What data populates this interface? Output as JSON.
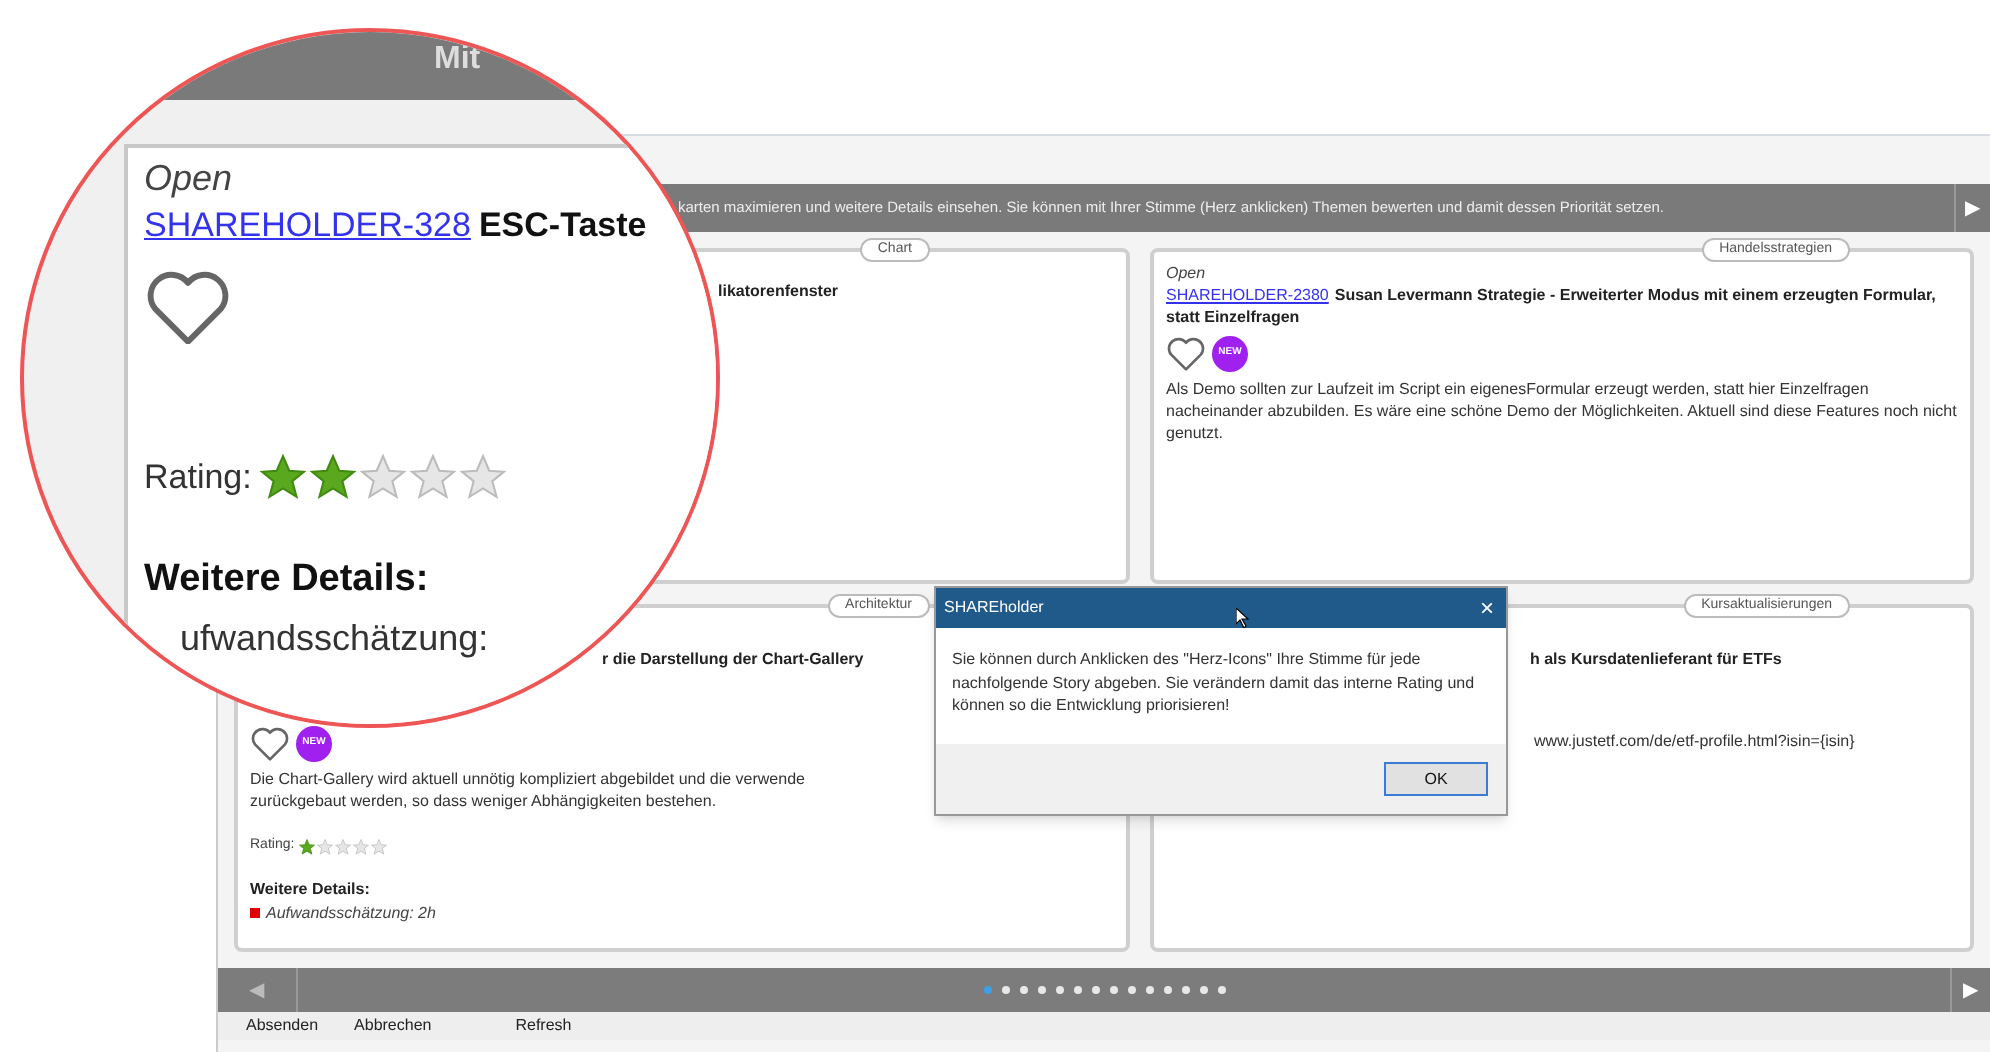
{
  "magnifier": {
    "header_text": "Mit",
    "status": "Open",
    "link": "SHAREHOLDER-328",
    "title": "ESC-Taste",
    "liked": false,
    "rating_label": "Rating:",
    "stars": 2,
    "details_heading": "Weitere Details:",
    "detail": "ufwandsschätzung:"
  },
  "info_bar": {
    "text": "karten maximieren und weitere Details einsehen. Sie können mit Ihrer Stimme (Herz anklicken) Themen bewerten und damit dessen Priorität setzen.",
    "next": "▶"
  },
  "cards": [
    {
      "category": "Chart",
      "title": "likatorenfenster"
    },
    {
      "category": "Handelsstrategien",
      "status": "Open",
      "link": "SHAREHOLDER-2380",
      "title": "Susan Levermann Strategie - Erweiterter Modus mit einem erzeugten Formular, statt Einzelfragen",
      "liked": false,
      "badge": "NEW",
      "body": [
        "Als Demo sollten zur Laufzeit im Script ein eigenesFormular erzeugt werden, statt hier Einzelfragen nacheinander abzubilden. Es wäre eine schöne Demo der Möglichkeiten. Aktuell sind diese Features noch nicht genutzt."
      ]
    },
    {
      "category": "Architektur",
      "title": "r die Darstellung der Chart-Gallery",
      "liked": false,
      "badge": "NEW",
      "body": [
        "Die Chart-Gallery wird aktuell unnötig kompliziert abgebildet und die verwende",
        "zurückgebaut werden, so dass weniger Abhängigkeiten bestehen."
      ],
      "rating_label": "Rating:",
      "stars": 1,
      "details_heading": "Weitere Details:",
      "details": [
        {
          "text": "Aufwandsschätzung: 2h",
          "color": "#e00000"
        }
      ]
    },
    {
      "category": "Kursaktualisierungen",
      "title": "h als Kursdatenlieferant für ETFs",
      "url": "www.justetf.com/de/etf-profile.html?isin={isin}"
    }
  ],
  "pager": {
    "prev": "◀",
    "next": "▶",
    "pages": [
      {
        "selected": true
      },
      {
        "selected": false
      },
      {
        "selected": false
      },
      {
        "selected": false
      },
      {
        "selected": false
      },
      {
        "selected": false
      },
      {
        "selected": false
      },
      {
        "selected": false
      },
      {
        "selected": false
      },
      {
        "selected": false
      },
      {
        "selected": false
      },
      {
        "selected": false
      },
      {
        "selected": false
      },
      {
        "selected": false
      }
    ]
  },
  "buttons": [
    "Absenden",
    "Abbrechen",
    "Refresh"
  ],
  "dialog": {
    "title": "SHAREholder",
    "close": "×",
    "message": "Sie können durch Anklicken des \"Herz-Icons\" Ihre Stimme für jede nachfolgende Story abgeben. Sie verändern damit das interne Rating und können so die Entwicklung priorisieren!",
    "ok": "OK"
  }
}
